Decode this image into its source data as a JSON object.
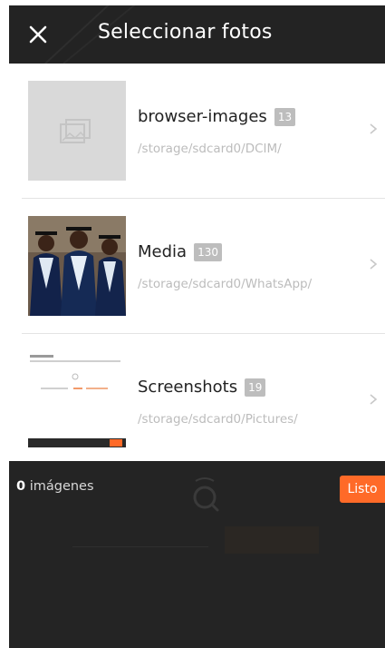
{
  "header": {
    "title": "Seleccionar fotos",
    "close_icon": "close-icon",
    "background": "#232323"
  },
  "folders": [
    {
      "name": "browser-images",
      "count": "13",
      "path": "/storage/sdcard0/DCIM/",
      "thumb": "placeholder-image-icon"
    },
    {
      "name": "Media",
      "count": "130",
      "path": "/storage/sdcard0/WhatsApp/",
      "thumb": "graduates-photo"
    },
    {
      "name": "Screenshots",
      "count": "19",
      "path": "/storage/sdcard0/Pictures/",
      "thumb": "screenshot-thumbnail"
    }
  ],
  "footer": {
    "selected_count": "0",
    "selected_label": "imágenes",
    "done_label": "Listo",
    "accent": "#ff6a28"
  }
}
